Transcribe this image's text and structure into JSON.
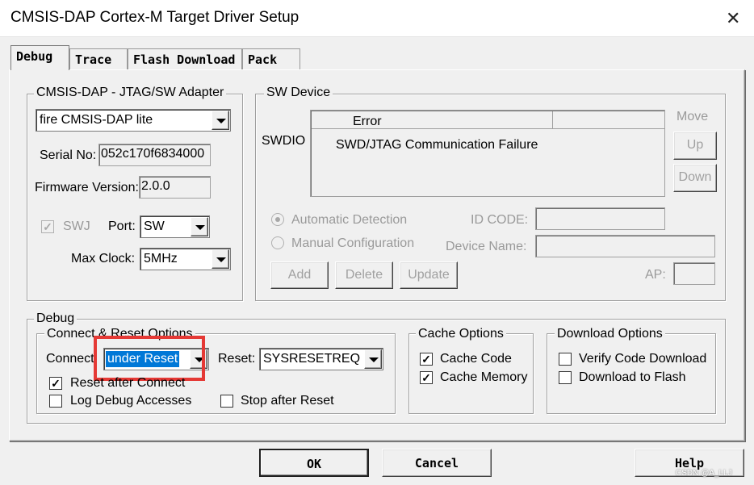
{
  "window": {
    "title": "CMSIS-DAP Cortex-M Target Driver Setup"
  },
  "tabs": [
    {
      "label": "Debug",
      "active": true
    },
    {
      "label": "Trace",
      "active": false
    },
    {
      "label": "Flash Download",
      "active": false
    },
    {
      "label": "Pack",
      "active": false
    }
  ],
  "adapter": {
    "legend": "CMSIS-DAP - JTAG/SW Adapter",
    "selected": "fire CMSIS-DAP lite",
    "serial_label": "Serial No:",
    "serial_value": "052c170f6834000",
    "firmware_label": "Firmware Version:",
    "firmware_value": "2.0.0",
    "swj_label": "SWJ",
    "port_label": "Port:",
    "port_value": "SW",
    "maxclock_label": "Max Clock:",
    "maxclock_value": "5MHz"
  },
  "sw_device": {
    "legend": "SW Device",
    "row_label": "SWDIO",
    "col_header": "Error",
    "row_value": "SWD/JTAG Communication Failure",
    "move_label": "Move",
    "up_label": "Up",
    "down_label": "Down",
    "auto_detect_label": "Automatic Detection",
    "manual_config_label": "Manual Configuration",
    "id_code_label": "ID CODE:",
    "device_name_label": "Device Name:",
    "ap_label": "AP:",
    "add_label": "Add",
    "delete_label": "Delete",
    "update_label": "Update"
  },
  "debug": {
    "legend": "Debug",
    "connect_reset_legend": "Connect & Reset Options",
    "connect_label": "Connect:",
    "connect_value": "under Reset",
    "reset_label": "Reset:",
    "reset_value": "SYSRESETREQ",
    "reset_after_connect_label": "Reset after Connect",
    "reset_after_connect_checked": true,
    "log_debug_label": "Log Debug Accesses",
    "log_debug_checked": false,
    "stop_after_reset_label": "Stop after Reset",
    "stop_after_reset_checked": false,
    "cache_legend": "Cache Options",
    "cache_code_label": "Cache Code",
    "cache_code_checked": true,
    "cache_memory_label": "Cache Memory",
    "cache_memory_checked": true,
    "download_legend": "Download Options",
    "verify_label": "Verify Code Download",
    "verify_checked": false,
    "download_flash_label": "Download to Flash",
    "download_flash_checked": false
  },
  "footer": {
    "ok_label": "OK",
    "cancel_label": "Cancel",
    "help_label": "Help",
    "watermark": "CSDN @A_LLJ"
  },
  "colors": {
    "annotation": "#e53935",
    "selection": "#0078d7"
  },
  "icons": {
    "close": "close-icon",
    "check": "checkmark-icon",
    "dropdown": "chevron-down-icon"
  }
}
